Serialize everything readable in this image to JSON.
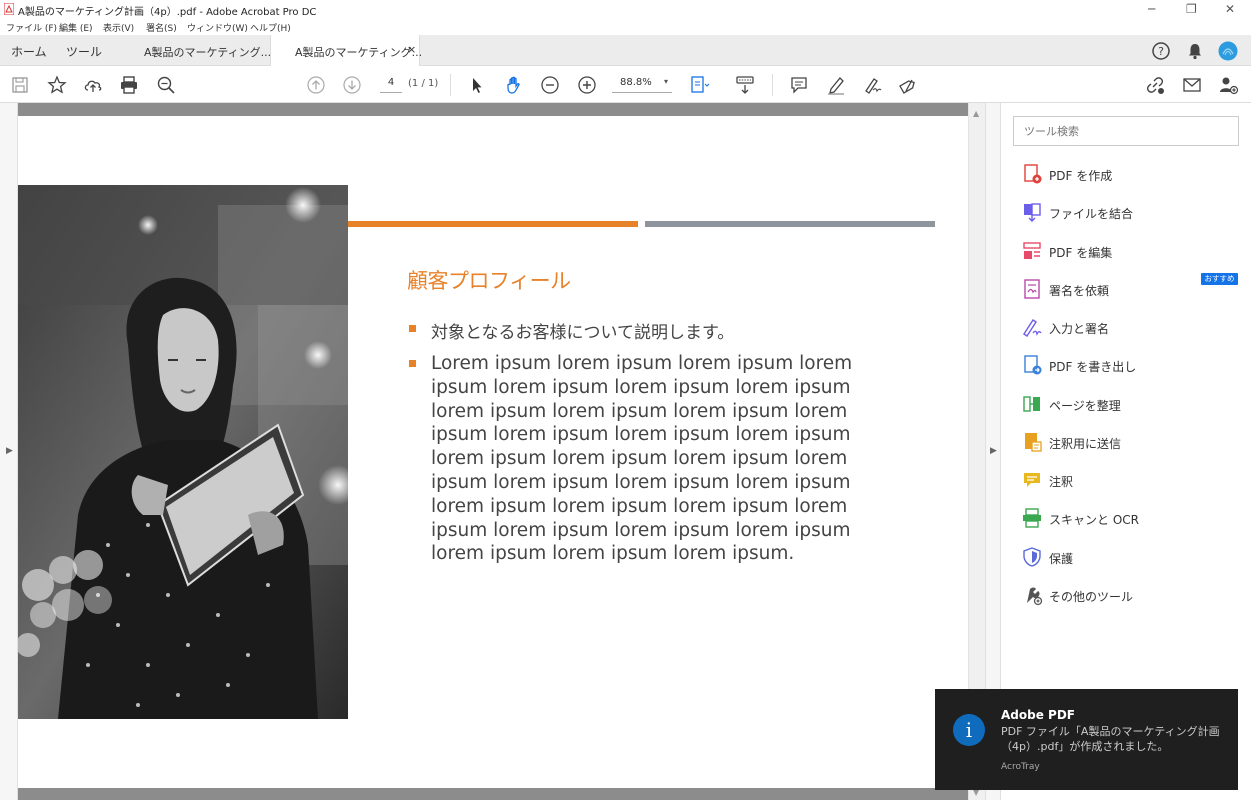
{
  "window": {
    "title": "A製品のマーケティング計画（4p）.pdf - Adobe Acrobat Pro DC",
    "minimize": "─",
    "restore": "❐",
    "close": "✕"
  },
  "menu": [
    "ファイル (F)",
    "編集 (E)",
    "表示(V)",
    "署名(S)",
    "ウィンドウ(W)",
    "ヘルプ(H)"
  ],
  "tabs": {
    "home": "ホーム",
    "tools": "ツール",
    "doc1": "A製品のマーケティング...",
    "doc2": "A製品のマーケティング...",
    "close": "×"
  },
  "toolbar": {
    "page_number": "4",
    "page_count": "(1 / 1)",
    "zoom": "88.8%",
    "zoom_caret": "▾"
  },
  "document": {
    "heading": "顧客プロフィール",
    "bullet1": "対象となるお客様について説明します。",
    "bullet2": "Lorem ipsum lorem ipsum lorem ipsum lorem ipsum lorem ipsum lorem ipsum lorem ipsum lorem ipsum lorem ipsum lorem ipsum lorem ipsum lorem ipsum lorem ipsum lorem ipsum lorem ipsum lorem ipsum lorem ipsum lorem ipsum lorem ipsum lorem ipsum lorem ipsum lorem ipsum lorem ipsum lorem ipsum lorem ipsum lorem ipsum lorem ipsum lorem ipsum lorem ipsum lorem ipsum lorem ipsum."
  },
  "tool_pane": {
    "search_placeholder": "ツール検索",
    "badge": "おすすめ",
    "items": [
      {
        "label": "PDF を作成",
        "icon": "create-pdf-icon",
        "color": "#e0403a"
      },
      {
        "label": "ファイルを結合",
        "icon": "combine-files-icon",
        "color": "#6b5ee8"
      },
      {
        "label": "PDF を編集",
        "icon": "edit-pdf-icon",
        "color": "#e84a6a"
      },
      {
        "label": "署名を依頼",
        "icon": "request-signature-icon",
        "color": "#b84aa8"
      },
      {
        "label": "入力と署名",
        "icon": "fill-sign-icon",
        "color": "#6b5ee8"
      },
      {
        "label": "PDF を書き出し",
        "icon": "export-pdf-icon",
        "color": "#3a7fd8"
      },
      {
        "label": "ページを整理",
        "icon": "organize-pages-icon",
        "color": "#3aa850"
      },
      {
        "label": "注釈用に送信",
        "icon": "send-comments-icon",
        "color": "#e8a020"
      },
      {
        "label": "注釈",
        "icon": "comment-icon",
        "color": "#e8b820"
      },
      {
        "label": "スキャンと OCR",
        "icon": "scan-ocr-icon",
        "color": "#3aa850"
      },
      {
        "label": "保護",
        "icon": "protect-icon",
        "color": "#5a6ad8"
      },
      {
        "label": "その他のツール",
        "icon": "more-tools-icon",
        "color": "#555555"
      }
    ]
  },
  "toast": {
    "title": "Adobe PDF",
    "message": "PDF ファイル「A製品のマーケティング計画（4p）.pdf」が作成されました。",
    "source": "AcroTray",
    "icon_glyph": "i"
  },
  "colors": {
    "accent_orange": "#e8822a",
    "accent_grey": "#8e959c",
    "brand_blue": "#1473e6"
  }
}
